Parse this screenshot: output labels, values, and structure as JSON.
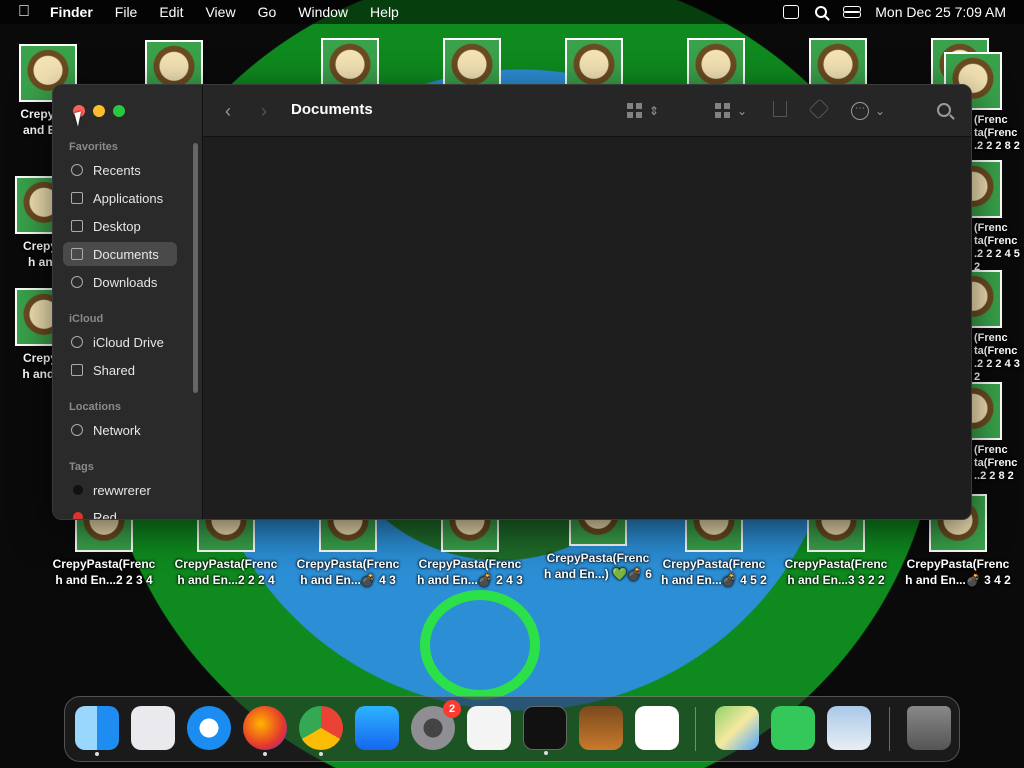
{
  "menubar": {
    "app_name": "Finder",
    "menus": [
      "File",
      "Edit",
      "View",
      "Go",
      "Window",
      "Help"
    ],
    "clock": "Mon Dec 25  7:09 AM"
  },
  "desktop": {
    "icon_top_labels": [
      "CrepyPas",
      "and En..."
    ],
    "icon_left1": [
      "CrepyP",
      "h and"
    ],
    "icon_left2": [
      "CrepyP",
      "h and E"
    ],
    "right_labels": [
      [
        "(Frenc",
        "ta(Frenc",
        ".2 2 2 8 2"
      ],
      [
        "(Frenc",
        "ta(Frenc",
        ".2 2 2 4 5 2"
      ],
      [
        "(Frenc",
        "ta(Frenc",
        ".2 2 2 4 3 2"
      ],
      [
        "(Frenc",
        "ta(Frenc",
        "..2 2 8 2"
      ]
    ],
    "bottom_labels": [
      [
        "CrepyPasta(Frenc",
        "h and En...2 2 3 4"
      ],
      [
        "CrepyPasta(Frenc",
        "h and En...2 2 2 4"
      ],
      [
        "CrepyPasta(Frenc",
        "h and En...💣 4 3"
      ],
      [
        "CrepyPasta(Frenc",
        "h and En...💣 2 4 3"
      ],
      [
        "CrepyPasta(Frenc",
        "h and En...) 💚💣 6"
      ],
      [
        "CrepyPasta(Frenc",
        "h and En...💣 4 5 2"
      ],
      [
        "CrepyPasta(Frenc",
        "h and En...3 3 2 2"
      ],
      [
        "CrepyPasta(Frenc",
        "h and En...💣 3 4 2"
      ]
    ]
  },
  "finder": {
    "title": "Documents",
    "sections": {
      "favorites": "Favorites",
      "icloud": "iCloud",
      "locations": "Locations",
      "tags": "Tags"
    },
    "favorites": [
      "Recents",
      "Applications",
      "Desktop",
      "Documents",
      "Downloads"
    ],
    "icloud": [
      "iCloud Drive",
      "Shared"
    ],
    "locations": [
      "Network"
    ],
    "tags": [
      "rewwrerer",
      "Red"
    ],
    "selected": "Documents"
  },
  "dock": {
    "apps": [
      "Finder",
      "Launchpad",
      "Safari",
      "Firefox",
      "Chrome",
      "App Store",
      "System Settings",
      "TextEdit",
      "Terminal",
      "GarageBand",
      "Visual Studio Code",
      "Maps",
      "Messages",
      "Preview",
      "Trash"
    ],
    "settings_badge": "2"
  }
}
